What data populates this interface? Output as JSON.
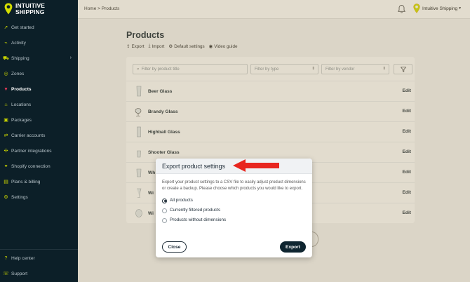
{
  "brand": {
    "line1": "INTUITIVE",
    "line2": "SHIPPING"
  },
  "sidebar": {
    "items": [
      {
        "label": "Get started",
        "icon": "rocket-icon"
      },
      {
        "label": "Activity",
        "icon": "activity-icon"
      },
      {
        "label": "Shipping",
        "icon": "truck-icon"
      },
      {
        "label": "Zones",
        "icon": "globe-icon"
      },
      {
        "label": "Products",
        "icon": "shirt-icon"
      },
      {
        "label": "Locations",
        "icon": "location-icon"
      },
      {
        "label": "Packages",
        "icon": "package-icon"
      },
      {
        "label": "Carrier accounts",
        "icon": "carrier-icon"
      },
      {
        "label": "Partner integrations",
        "icon": "plug-icon"
      },
      {
        "label": "Shopify connection",
        "icon": "shopify-icon"
      },
      {
        "label": "Plans & billing",
        "icon": "billing-icon"
      },
      {
        "label": "Settings",
        "icon": "gear-icon"
      }
    ],
    "bottom": [
      {
        "label": "Help center",
        "icon": "help-icon"
      },
      {
        "label": "Support",
        "icon": "support-icon"
      }
    ]
  },
  "topbar": {
    "breadcrumb": "Home > Products",
    "account": "Intuitive Shipping"
  },
  "page": {
    "title": "Products",
    "actions": [
      "Export",
      "Import",
      "Default settings",
      "Video guide"
    ]
  },
  "filters": {
    "title_placeholder": "Filter by product title",
    "type_placeholder": "Filter by type",
    "vendor_placeholder": "Filter by vendor"
  },
  "products": [
    {
      "name": "Beer Glass",
      "edit": "Edit"
    },
    {
      "name": "Brandy Glass",
      "edit": "Edit"
    },
    {
      "name": "Highball Glass",
      "edit": "Edit"
    },
    {
      "name": "Shooter Glass",
      "edit": "Edit"
    },
    {
      "name": "Wh",
      "edit": "Edit"
    },
    {
      "name": "Wi",
      "edit": "Edit"
    },
    {
      "name": "Wi",
      "edit": "Edit"
    }
  ],
  "modal": {
    "title": "Export product settings",
    "description": "Export your product settings to a CSV file to easily adjust product dimensions or create a backup. Please choose which products you would like to export.",
    "options": [
      "All products",
      "Currently filtered products",
      "Products without dimensions"
    ],
    "selected_option": "All products",
    "close_label": "Close",
    "export_label": "Export"
  },
  "colors": {
    "sidebar_bg": "#0c1f28",
    "active_icon": "#ef3b5a",
    "brand_yellow": "#c9d400",
    "annotation_arrow": "#e8261f"
  }
}
